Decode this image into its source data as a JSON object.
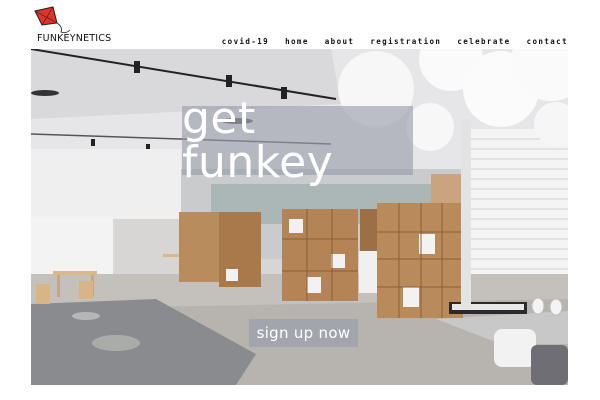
{
  "brand": {
    "name": "FUNKEYNETICS",
    "accent": "#e0322a"
  },
  "nav": {
    "items": [
      {
        "label": "covid-19"
      },
      {
        "label": "home"
      },
      {
        "label": "about"
      },
      {
        "label": "registration"
      },
      {
        "label": "celebrate"
      },
      {
        "label": "contact"
      }
    ]
  },
  "hero": {
    "headline": "get funkey",
    "cta_label": "sign up now",
    "overlay_color": "#969baa"
  }
}
